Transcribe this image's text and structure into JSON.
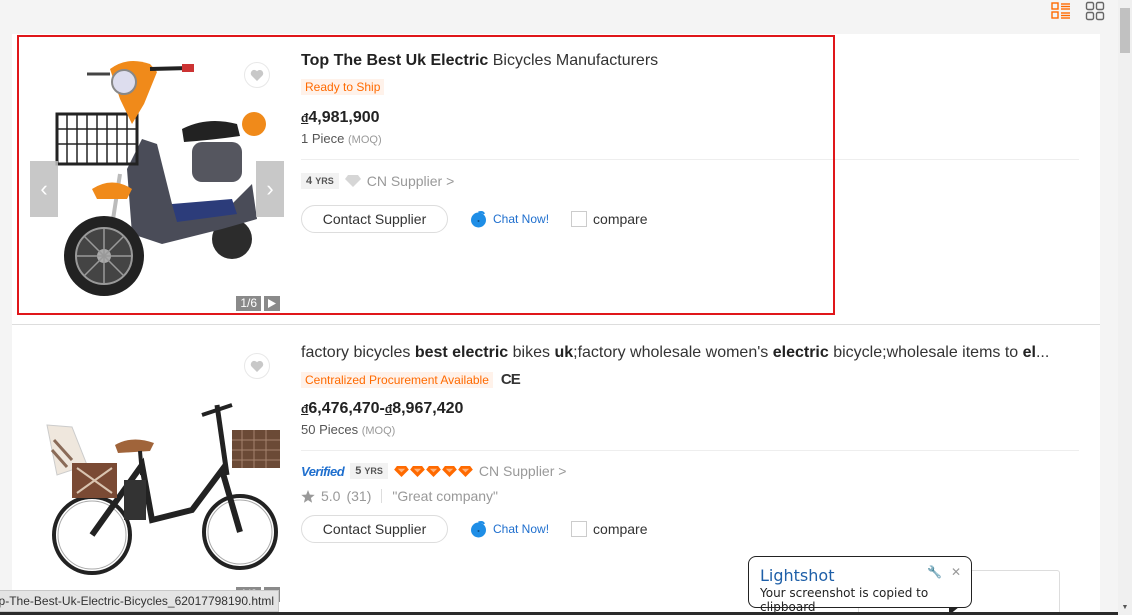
{
  "view_toggle": {
    "list_icon": "list-view-icon",
    "grid_icon": "grid-view-icon",
    "active": "list",
    "active_color": "#ff6a00",
    "inactive_color": "#666666"
  },
  "products": [
    {
      "title_parts": [
        {
          "text": "Top The Best Uk Electric",
          "bold": true
        },
        {
          "text": " Bicycles Manufacturers",
          "bold": false
        }
      ],
      "tags": [
        "Ready to Ship"
      ],
      "ce_mark": false,
      "currency": "đ",
      "price": "4,981,900",
      "price_range_end": null,
      "moq_value": "1 Piece",
      "moq_label": "(MOQ)",
      "verified": false,
      "verified_label": "",
      "years": "4",
      "years_unit": "YRS",
      "diamonds": 0,
      "supplier": "CN Supplier",
      "supplier_chevron": ">",
      "rating": null,
      "review_count": null,
      "review_quote": null,
      "contact_label": "Contact Supplier",
      "chat_label": "Chat Now!",
      "compare_label": "compare",
      "image_counter": "1/6",
      "image_alt": "orange electric scooter bicycle with front basket",
      "highlighted": true
    },
    {
      "title_parts": [
        {
          "text": "factory bicycles ",
          "bold": false
        },
        {
          "text": "best electric",
          "bold": true
        },
        {
          "text": " bikes ",
          "bold": false
        },
        {
          "text": "uk",
          "bold": true
        },
        {
          "text": ";factory wholesale women's ",
          "bold": false
        },
        {
          "text": "electric",
          "bold": true
        },
        {
          "text": " bicycle;wholesale items to ",
          "bold": false
        },
        {
          "text": "el",
          "bold": true
        },
        {
          "text": "...",
          "bold": false
        }
      ],
      "tags": [
        "Centralized Procurement Available"
      ],
      "ce_mark": true,
      "ce_label": "CE",
      "currency": "đ",
      "price": "6,476,470",
      "price_range_end": "8,967,420",
      "moq_value": "50 Pieces",
      "moq_label": "(MOQ)",
      "verified": true,
      "verified_label": "Verified",
      "years": "5",
      "years_unit": "YRS",
      "diamonds": 5,
      "diamond_color": "#ff6a00",
      "supplier": "CN Supplier",
      "supplier_chevron": ">",
      "rating": "5.0",
      "review_count": "(31)",
      "review_quote": "\"Great company\"",
      "contact_label": "Contact Supplier",
      "chat_label": "Chat Now!",
      "compare_label": "compare",
      "image_counter": "1/6",
      "image_alt": "black electric city bicycle with child seat and wicker basket",
      "highlighted": false
    }
  ],
  "status_bar": {
    "url_text": "op-The-Best-Uk-Electric-Bicycles_62017798190.html"
  },
  "lightshot": {
    "title": "Lightshot",
    "message": "Your screenshot is copied to clipboard",
    "settings_icon": "wrench-icon",
    "close_icon": "close-icon"
  },
  "colors": {
    "accent": "#ff6a00",
    "highlight_border": "#e0161a",
    "link_blue": "#1f6fce"
  }
}
